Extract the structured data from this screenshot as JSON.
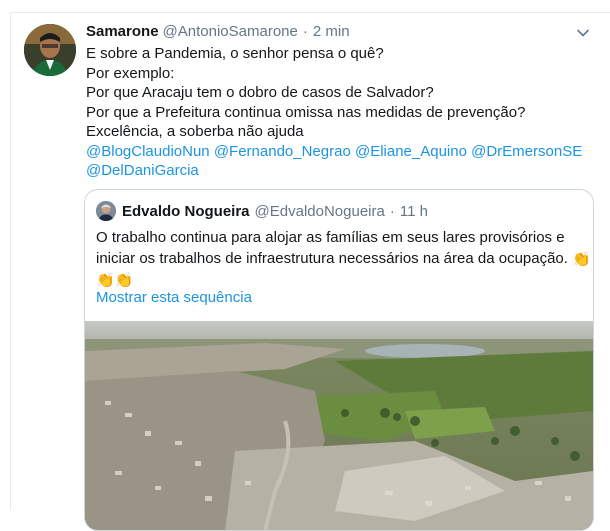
{
  "tweet": {
    "author_name": "Samarone",
    "author_handle": "@AntonioSamarone",
    "separator": "·",
    "time": "2 min",
    "lines": [
      "E sobre a Pandemia, o senhor pensa o quê?",
      "Por exemplo:",
      "Por que Aracaju tem o dobro de casos de Salvador?",
      "Por que a Prefeitura continua omissa nas medidas de prevenção?",
      "Excelência, a soberba não ajuda"
    ],
    "mentions": [
      "@BlogClaudioNun",
      "@Fernando_Negrao",
      "@Eliane_Aquino",
      "@DrEmersonSE",
      "@DelDaniGarcia"
    ]
  },
  "quoted": {
    "author_name": "Edvaldo Nogueira",
    "author_handle": "@EdvaldoNogueira",
    "separator": "·",
    "time": "11 h",
    "line1": "O trabalho continua para alojar as famílias em seus lares provisórios e",
    "line2": "iniciar os trabalhos de infraestrutura necessários na área da ocupação.",
    "clap": "👏",
    "show_thread": "Mostrar esta sequência"
  },
  "icons": {
    "caret": "chevron-down-icon",
    "emoji": "clapping-hands-icon"
  },
  "colors": {
    "link": "#1b95e0",
    "secondary_text": "#657786",
    "border": "#ccd6dd"
  }
}
